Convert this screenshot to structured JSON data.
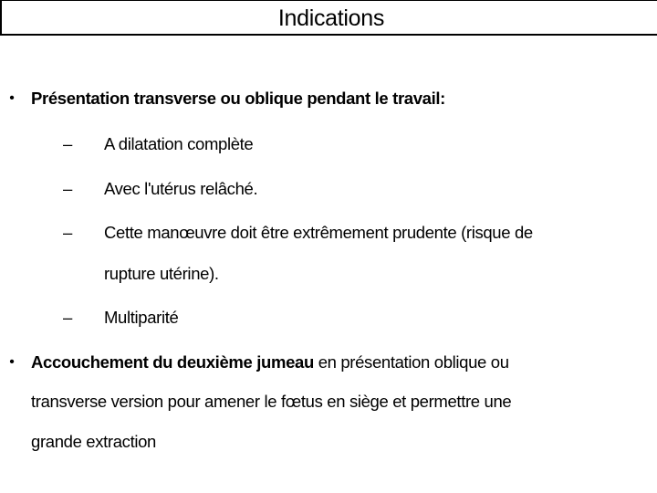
{
  "title": "Indications",
  "bullet_glyph": "•",
  "dash_glyph": "–",
  "bullets": [
    {
      "bold_text": "Présentation transverse ou oblique pendant le travail:",
      "sub_items": [
        {
          "lines": [
            "A dilatation complète"
          ]
        },
        {
          "lines": [
            "Avec l'utérus relâché."
          ]
        },
        {
          "lines": [
            "Cette manœuvre doit être extrêmement prudente (risque de",
            "rupture utérine)."
          ]
        },
        {
          "lines": [
            "Multiparité"
          ]
        }
      ]
    },
    {
      "bold_text": "Accouchement du deuxième jumeau",
      "text_line_1": " en présentation oblique ou",
      "text_line_2": "transverse version pour amener le fœtus en siège et permettre une",
      "text_line_3": "grande extraction"
    }
  ]
}
